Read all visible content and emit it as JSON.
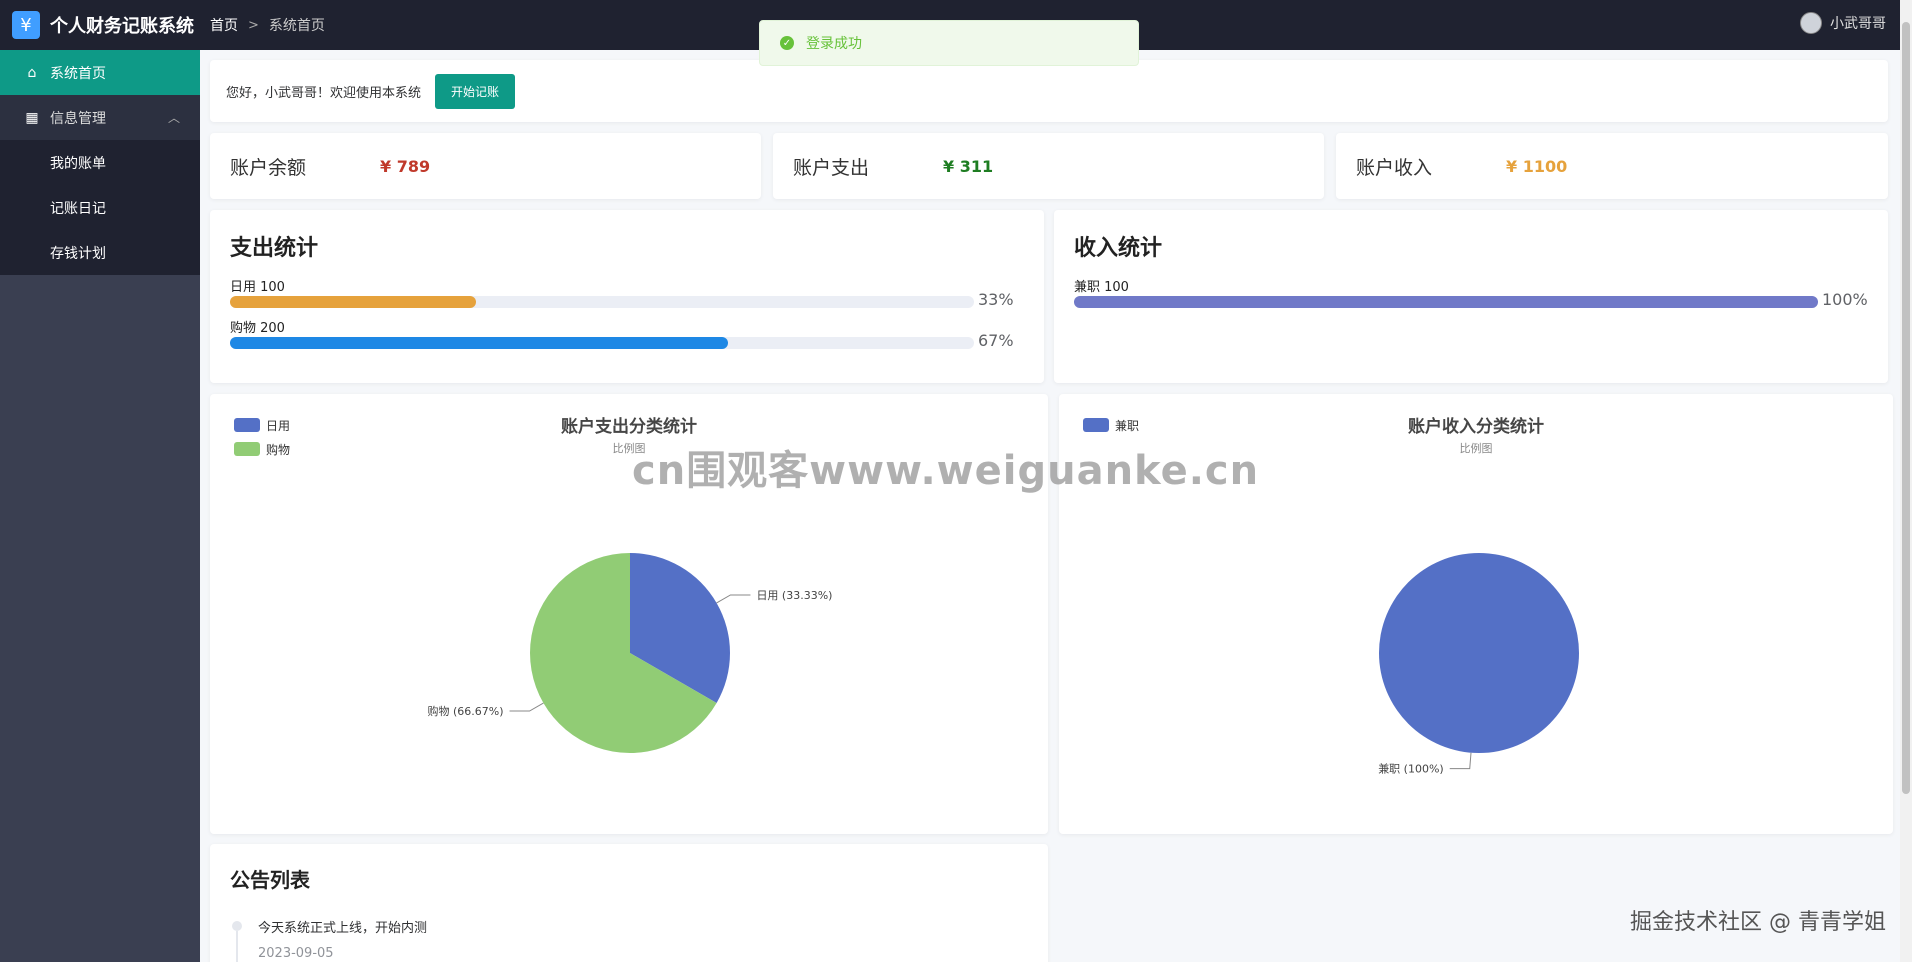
{
  "header": {
    "logo_glyph": "¥",
    "app_title": "个人财务记账系统",
    "breadcrumb": [
      "首页",
      "系统首页"
    ],
    "breadcrumb_sep": ">",
    "user_name": "小武哥哥"
  },
  "toast": {
    "message": "登录成功",
    "icon": "check-circle-icon"
  },
  "sidebar": {
    "items": [
      {
        "label": "系统首页",
        "icon": "home-icon",
        "active": true
      },
      {
        "label": "信息管理",
        "icon": "grid-icon",
        "expanded": true
      }
    ],
    "submenu": [
      {
        "label": "我的账单"
      },
      {
        "label": "记账日记"
      },
      {
        "label": "存钱计划"
      }
    ]
  },
  "welcome": {
    "text": "您好，小武哥哥！欢迎使用本系统",
    "button": "开始记账"
  },
  "stats": [
    {
      "label": "账户余额",
      "value": "¥ 789",
      "color": "#c0392b"
    },
    {
      "label": "账户支出",
      "value": "¥ 311",
      "color": "#1e7d22"
    },
    {
      "label": "账户收入",
      "value": "¥ 1100",
      "color": "#e6a23c"
    }
  ],
  "expense_stats": {
    "title": "支出统计",
    "rows": [
      {
        "label": "日用 100",
        "percent": 33,
        "percent_text": "33%",
        "color": "#e6a23c"
      },
      {
        "label": "购物 200",
        "percent": 67,
        "percent_text": "67%",
        "color": "#1e88e5"
      }
    ]
  },
  "income_stats": {
    "title": "收入统计",
    "rows": [
      {
        "label": "兼职 100",
        "percent": 100,
        "percent_text": "100%",
        "color": "#7079c8"
      }
    ]
  },
  "chart_data": [
    {
      "type": "pie",
      "title": "账户支出分类统计",
      "subtitle": "比例图",
      "legend": [
        "日用",
        "购物"
      ],
      "slices": [
        {
          "name": "日用",
          "value": 33.33,
          "label": "日用 (33.33%)",
          "color": "#5470c6"
        },
        {
          "name": "购物",
          "value": 66.67,
          "label": "购物 (66.67%)",
          "color": "#91cc75"
        }
      ]
    },
    {
      "type": "pie",
      "title": "账户收入分类统计",
      "subtitle": "比例图",
      "legend": [
        "兼职"
      ],
      "slices": [
        {
          "name": "兼职",
          "value": 100,
          "label": "兼职 (100%)",
          "color": "#5470c6"
        }
      ]
    }
  ],
  "notice": {
    "title": "公告列表",
    "items": [
      {
        "text": "今天系统正式上线，开始内测",
        "date": "2023-09-05"
      }
    ]
  },
  "watermark": "cn围观客www.weiguanke.cn",
  "credit": "掘金技术社区 @ 青青学姐"
}
